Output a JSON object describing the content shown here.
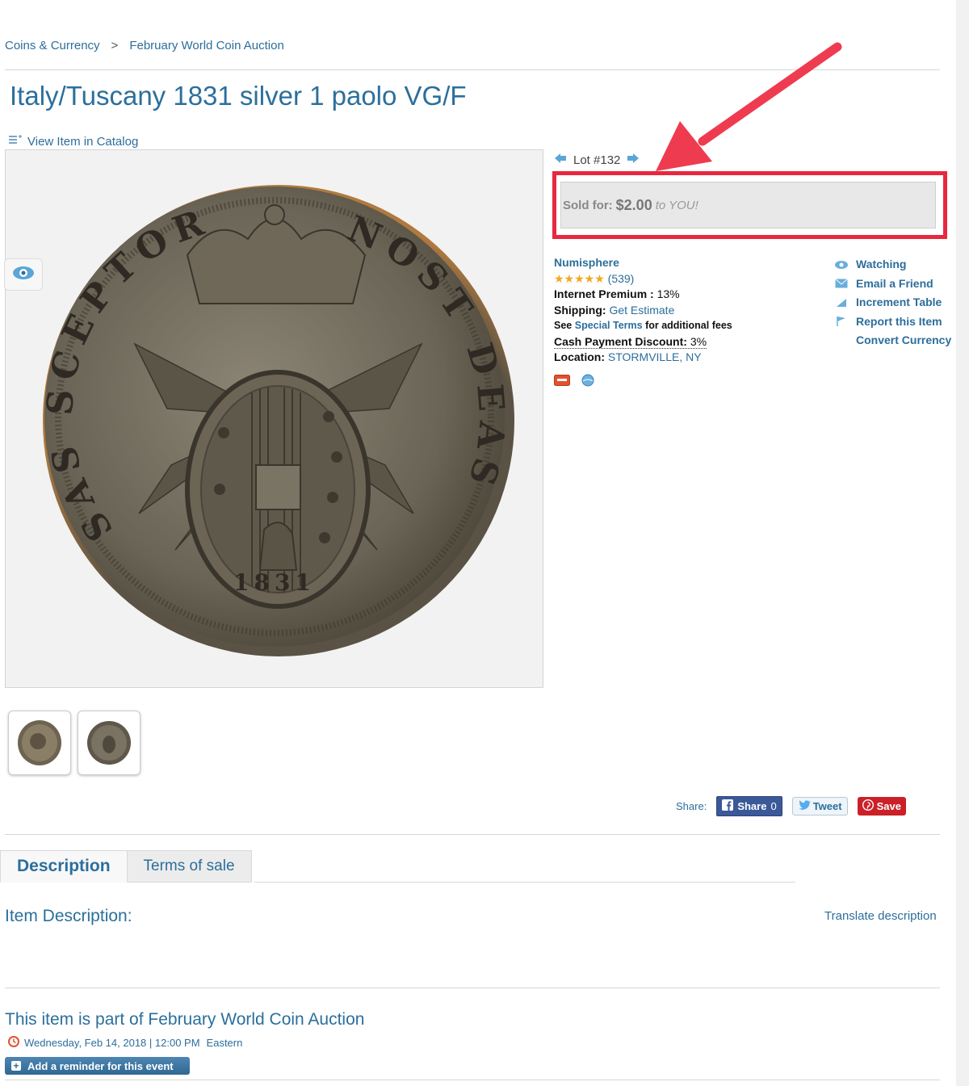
{
  "breadcrumb": {
    "items": [
      "Coins & Currency",
      "February World Coin Auction"
    ],
    "separator": ">"
  },
  "title": "Italy/Tuscany 1831 silver 1 paolo VG/F",
  "catalog_link": "View Item in Catalog",
  "lot": {
    "label": "Lot #132"
  },
  "sold": {
    "label": "Sold for:",
    "amount": "$2.00",
    "suffix": "to YOU!"
  },
  "seller": {
    "name": "Numisphere",
    "reviews": "(539)",
    "rating_stars": 5,
    "internet_premium_label": "Internet Premium :",
    "internet_premium_value": "13%",
    "shipping_label": "Shipping:",
    "shipping_value": "Get Estimate",
    "terms_prefix": "See",
    "terms_link": "Special Terms",
    "terms_suffix": "for additional fees",
    "cash_label": "Cash Payment Discount:",
    "cash_value": "3%",
    "location_label": "Location:",
    "location_value": "STORMVILLE, NY"
  },
  "actions": [
    {
      "label": "Watching",
      "icon": "eye-icon"
    },
    {
      "label": "Email a Friend",
      "icon": "envelope-icon"
    },
    {
      "label": "Increment Table",
      "icon": "increment-icon"
    },
    {
      "label": "Report this Item",
      "icon": "flag-icon"
    },
    {
      "label": "Convert Currency",
      "icon": ""
    }
  ],
  "share": {
    "label": "Share:",
    "facebook": "Share",
    "facebook_count": "0",
    "twitter": "Tweet",
    "pinterest": "Save"
  },
  "tabs": [
    {
      "label": "Description",
      "active": true
    },
    {
      "label": "Terms of sale",
      "active": false
    }
  ],
  "description": {
    "heading": "Item Description:",
    "translate": "Translate description"
  },
  "event": {
    "heading": "This item is part of February World Coin Auction",
    "date": "Wednesday, Feb 14, 2018 | 12:00 PM",
    "timezone": "Eastern",
    "reminder_button": "Add a reminder for this event"
  },
  "coin": {
    "legend_left": "SAS SCEPTOR",
    "legend_right": "NOST DEAS",
    "year": "1831"
  },
  "colors": {
    "link": "#2c6e9b",
    "annotation_red": "#e8283f",
    "star_gold": "#f2a81d"
  }
}
